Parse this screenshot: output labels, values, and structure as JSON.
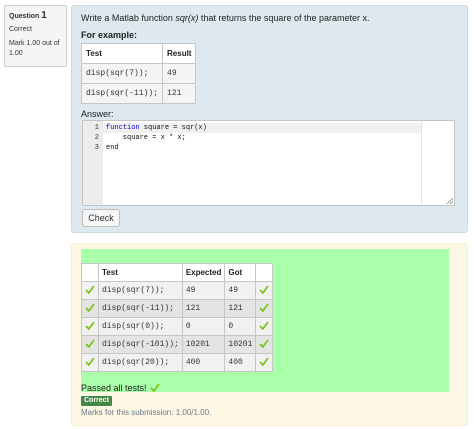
{
  "info": {
    "question_label": "Question",
    "question_number": "1",
    "state": "Correct",
    "grade": "Mark 1.00 out of 1.00"
  },
  "question": {
    "text_prefix": "Write a Matlab function ",
    "text_func": "sqr(x)",
    "text_suffix": " that returns the square of the parameter x.",
    "for_example": "For example:",
    "examples": {
      "headers": [
        "Test",
        "Result"
      ],
      "rows": [
        {
          "test": "disp(sqr(7));",
          "result": "49"
        },
        {
          "test": "disp(sqr(-11));",
          "result": "121"
        }
      ]
    },
    "answer_label": "Answer:",
    "code_lines": [
      {
        "num": "1",
        "text": "function square = sqr(x)"
      },
      {
        "num": "2",
        "text": "    square = x * x;"
      },
      {
        "num": "3",
        "text": "end"
      }
    ],
    "check_label": "Check"
  },
  "results": {
    "headers": [
      "Test",
      "Expected",
      "Got"
    ],
    "rows": [
      {
        "test": "disp(sqr(7));",
        "expected": "49",
        "got": "49"
      },
      {
        "test": "disp(sqr(-11));",
        "expected": "121",
        "got": "121"
      },
      {
        "test": "disp(sqr(0));",
        "expected": "0",
        "got": "0"
      },
      {
        "test": "disp(sqr(-101));",
        "expected": "10201",
        "got": "10201"
      },
      {
        "test": "disp(sqr(20));",
        "expected": "400",
        "got": "400"
      }
    ],
    "passed_text": "Passed all tests!",
    "badge": "Correct",
    "marks": "Marks for this submission: 1.00/1.00."
  },
  "colors": {
    "formulation_bg": "#dee9ef",
    "outcome_bg": "#fcf8e3",
    "pass_bg": "#aaffaa",
    "tick_green": "#7cc61a",
    "badge_green": "#468847",
    "keyword_blue": "#0000cc"
  },
  "icons": {
    "row_status": "check-icon",
    "resize": "resize-handle-icon"
  }
}
